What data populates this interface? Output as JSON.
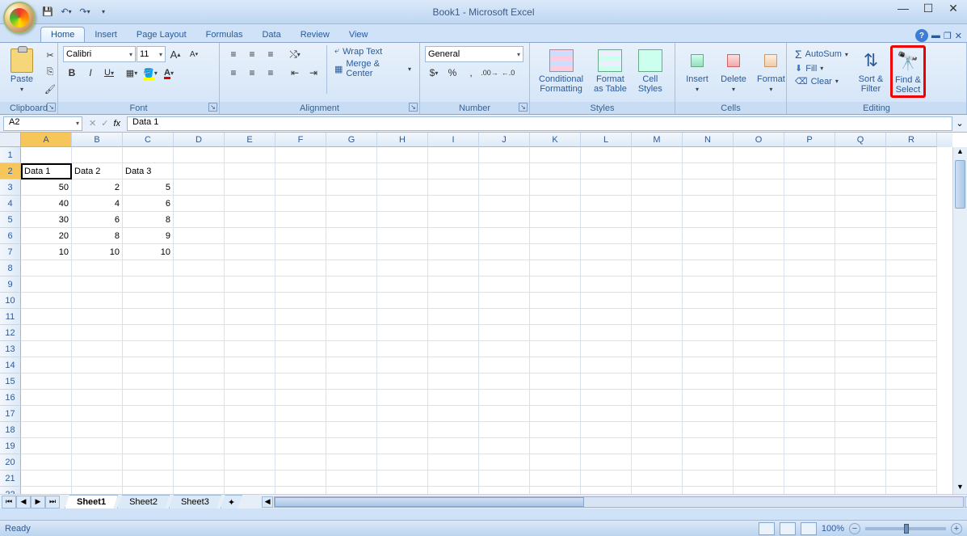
{
  "title": "Book1 - Microsoft Excel",
  "qat": {
    "save": "💾",
    "undo": "↶",
    "redo": "↷"
  },
  "tabs": [
    "Home",
    "Insert",
    "Page Layout",
    "Formulas",
    "Data",
    "Review",
    "View"
  ],
  "active_tab": 0,
  "ribbon": {
    "clipboard": {
      "label": "Clipboard",
      "paste": "Paste"
    },
    "font": {
      "label": "Font",
      "name": "Calibri",
      "size": "11",
      "bold": "B",
      "italic": "I",
      "underline": "U"
    },
    "alignment": {
      "label": "Alignment",
      "wrap": "Wrap Text",
      "merge": "Merge & Center"
    },
    "number": {
      "label": "Number",
      "format": "General"
    },
    "styles": {
      "label": "Styles",
      "cond": "Conditional\nFormatting",
      "table": "Format\nas Table",
      "cell": "Cell\nStyles"
    },
    "cells": {
      "label": "Cells",
      "insert": "Insert",
      "delete": "Delete",
      "format": "Format"
    },
    "editing": {
      "label": "Editing",
      "autosum": "AutoSum",
      "fill": "Fill",
      "clear": "Clear",
      "sort": "Sort &\nFilter",
      "find": "Find &\nSelect"
    }
  },
  "name_box": "A2",
  "formula": "Data 1",
  "columns": [
    "A",
    "B",
    "C",
    "D",
    "E",
    "F",
    "G",
    "H",
    "I",
    "J",
    "K",
    "L",
    "M",
    "N",
    "O",
    "P",
    "Q",
    "R"
  ],
  "row_count": 22,
  "selected_cell": {
    "row": 2,
    "col": 0
  },
  "cell_data": {
    "2": {
      "0": "Data 1",
      "1": "Data 2",
      "2": "Data 3"
    },
    "3": {
      "0": "50",
      "1": "2",
      "2": "5"
    },
    "4": {
      "0": "40",
      "1": "4",
      "2": "6"
    },
    "5": {
      "0": "30",
      "1": "6",
      "2": "8"
    },
    "6": {
      "0": "20",
      "1": "8",
      "2": "9"
    },
    "7": {
      "0": "10",
      "1": "10",
      "2": "10"
    }
  },
  "numeric_rows": [
    3,
    4,
    5,
    6,
    7
  ],
  "sheets": [
    "Sheet1",
    "Sheet2",
    "Sheet3"
  ],
  "active_sheet": 0,
  "status": "Ready",
  "zoom": "100%"
}
